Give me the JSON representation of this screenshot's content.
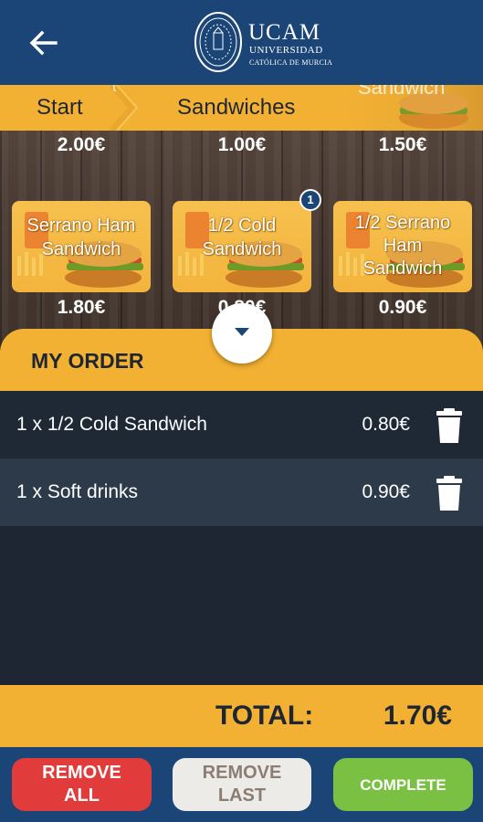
{
  "header": {
    "back_icon": "arrow-left-icon",
    "logo_title": "UCAM",
    "logo_subtitle": "UNIVERSIDAD",
    "logo_tagline": "CATÓLICA DE MURCIA"
  },
  "breadcrumb": {
    "items": [
      "Start",
      "Sandwiches"
    ],
    "overflow_text": "Sandwich"
  },
  "top_prices": [
    "2.00€",
    "1.00€",
    "1.50€"
  ],
  "products": [
    {
      "name": "Serrano Ham Sandwich",
      "lines": [
        "Serrano Ham",
        "Sandwich"
      ],
      "price": "1.80€",
      "badge": ""
    },
    {
      "name": "1/2 Cold Sandwich",
      "lines": [
        "1/2 Cold",
        "Sandwich"
      ],
      "price": "0.80€",
      "badge": "1"
    },
    {
      "name": "1/2 Serrano Ham Sandwich",
      "lines": [
        "1/2 Serrano",
        "Ham",
        "Sandwich"
      ],
      "price": "0.90€",
      "badge": ""
    }
  ],
  "order": {
    "title": "MY ORDER",
    "items": [
      {
        "qty": "1 x 1/2 Cold Sandwich",
        "amount": "0.80€"
      },
      {
        "qty": "1 x Soft drinks",
        "amount": "0.90€"
      }
    ]
  },
  "total": {
    "label": "TOTAL:",
    "value": "1.70€"
  },
  "footer": {
    "remove_all": "REMOVE ALL",
    "remove_last": "REMOVE LAST",
    "complete": "COMPLETE"
  },
  "colors": {
    "primary": "#1b4576",
    "accent": "#f2b133",
    "danger": "#e23b3b",
    "success": "#7ac043",
    "panel": "#1d2632"
  }
}
